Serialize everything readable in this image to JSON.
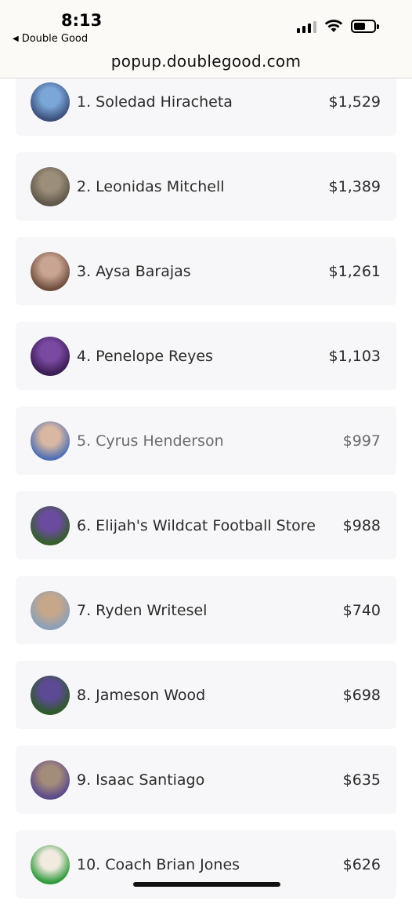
{
  "status": {
    "time": "8:13",
    "back_label": "Double Good",
    "url": "popup.doublegood.com"
  },
  "colors": {
    "card_bg": "#f7f7f9",
    "text": "#2b2b2b",
    "faded_text": "#6b6b6b"
  },
  "leaderboard": [
    {
      "rank_name": "1. Soledad Hiracheta",
      "amount": "$1,529",
      "avatar_colors": [
        "#7aa6d8",
        "#3c4f7a"
      ]
    },
    {
      "rank_name": "2. Leonidas Mitchell",
      "amount": "$1,389",
      "avatar_colors": [
        "#9c8f7a",
        "#5e5649"
      ]
    },
    {
      "rank_name": "3. Aysa Barajas",
      "amount": "$1,261",
      "avatar_colors": [
        "#c9a493",
        "#6e4d3e"
      ]
    },
    {
      "rank_name": "4. Penelope Reyes",
      "amount": "$1,103",
      "avatar_colors": [
        "#7a4aa2",
        "#3a1d52"
      ]
    },
    {
      "rank_name": "5. Cyrus Henderson",
      "amount": "$997",
      "avatar_colors": [
        "#d8b7a3",
        "#4f6fb4"
      ]
    },
    {
      "rank_name": "6. Elijah's Wildcat Football Store",
      "amount": "$988",
      "avatar_colors": [
        "#6b4ba0",
        "#355f2b"
      ]
    },
    {
      "rank_name": "7. Ryden Writesel",
      "amount": "$740",
      "avatar_colors": [
        "#c7a78a",
        "#8aa0b8"
      ]
    },
    {
      "rank_name": "8. Jameson Wood",
      "amount": "$698",
      "avatar_colors": [
        "#5c4a94",
        "#2f5a2a"
      ]
    },
    {
      "rank_name": "9. Isaac Santiago",
      "amount": "$635",
      "avatar_colors": [
        "#a48c7a",
        "#5b4b8a"
      ]
    },
    {
      "rank_name": "10. Coach Brian Jones",
      "amount": "$626",
      "avatar_colors": [
        "#f1eadf",
        "#2f9a3b"
      ]
    }
  ]
}
